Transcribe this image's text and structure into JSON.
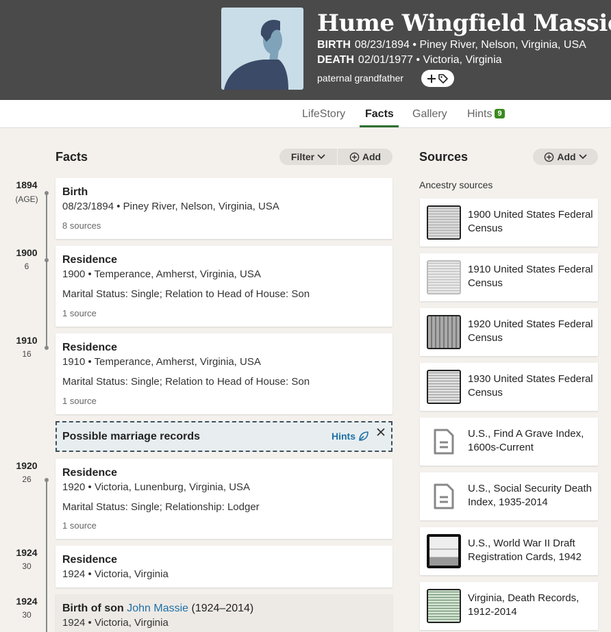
{
  "person": {
    "name": "Hume Wingfield Massie",
    "birth_label": "BIRTH",
    "birth_value": "08/23/1894 • Piney River, Nelson, Virginia, USA",
    "death_label": "DEATH",
    "death_value": "02/01/1977 • Victoria, Virginia",
    "relation": "paternal grandfather"
  },
  "tabs": [
    {
      "label": "LifeStory"
    },
    {
      "label": "Facts"
    },
    {
      "label": "Gallery"
    },
    {
      "label": "Hints",
      "badge": "9"
    }
  ],
  "facts": {
    "title": "Facts",
    "filter_label": "Filter",
    "add_label": "Add",
    "timeline": [
      {
        "year": "1894",
        "age": "(AGE)"
      },
      {
        "year": "1900",
        "age": "6"
      },
      {
        "year": "1910",
        "age": "16"
      },
      {
        "year": "1920",
        "age": "26"
      },
      {
        "year": "1924",
        "age": "30"
      },
      {
        "year": "1924",
        "age": "30"
      }
    ],
    "items": [
      {
        "title": "Birth",
        "line1": "08/23/1894 • Piney River, Nelson, Virginia, USA",
        "sources": "8 sources"
      },
      {
        "title": "Residence",
        "line1": "1900 • Temperance, Amherst, Virginia, USA",
        "line2": "Marital Status: Single; Relation to Head of House: Son",
        "sources": "1 source"
      },
      {
        "title": "Residence",
        "line1": "1910 • Temperance, Amherst, Virginia, USA",
        "line2": "Marital Status: Single; Relation to Head of House: Son",
        "sources": "1 source"
      },
      {
        "title": "Residence",
        "line1": "1920 • Victoria, Lunenburg, Virginia, USA",
        "line2": "Marital Status: Single; Relationship: Lodger",
        "sources": "1 source"
      },
      {
        "title": "Residence",
        "line1": "1924 • Victoria, Virginia"
      },
      {
        "title_prefix": "Birth of son ",
        "title_link": "John Massie",
        "title_suffix": " (1924–2014)",
        "line1": "1924 • Victoria, Virginia"
      }
    ],
    "hint": {
      "title": "Possible marriage records",
      "link": "Hints"
    }
  },
  "sources": {
    "title": "Sources",
    "add_label": "Add",
    "group_label": "Ancestry sources",
    "items": [
      {
        "title": "1900 United States Federal Census",
        "thumb": "census-image"
      },
      {
        "title": "1910 United States Federal Census",
        "thumb": "census-image"
      },
      {
        "title": "1920 United States Federal Census",
        "thumb": "census-image"
      },
      {
        "title": "1930 United States Federal Census",
        "thumb": "census-image"
      },
      {
        "title": "U.S., Find A Grave Index, 1600s-Current",
        "thumb": "document-icon"
      },
      {
        "title": "U.S., Social Security Death Index, 1935-2014",
        "thumb": "document-icon"
      },
      {
        "title": "U.S., World War II Draft Registration Cards, 1942",
        "thumb": "draft-card-image"
      },
      {
        "title": "Virginia, Death Records, 1912-2014",
        "thumb": "death-record-image"
      }
    ]
  },
  "colors": {
    "header_bg": "#4a4a4a",
    "accent_green": "#2f6e2f",
    "link_blue": "#1f6fa6",
    "badge_green": "#3a8a1e"
  }
}
